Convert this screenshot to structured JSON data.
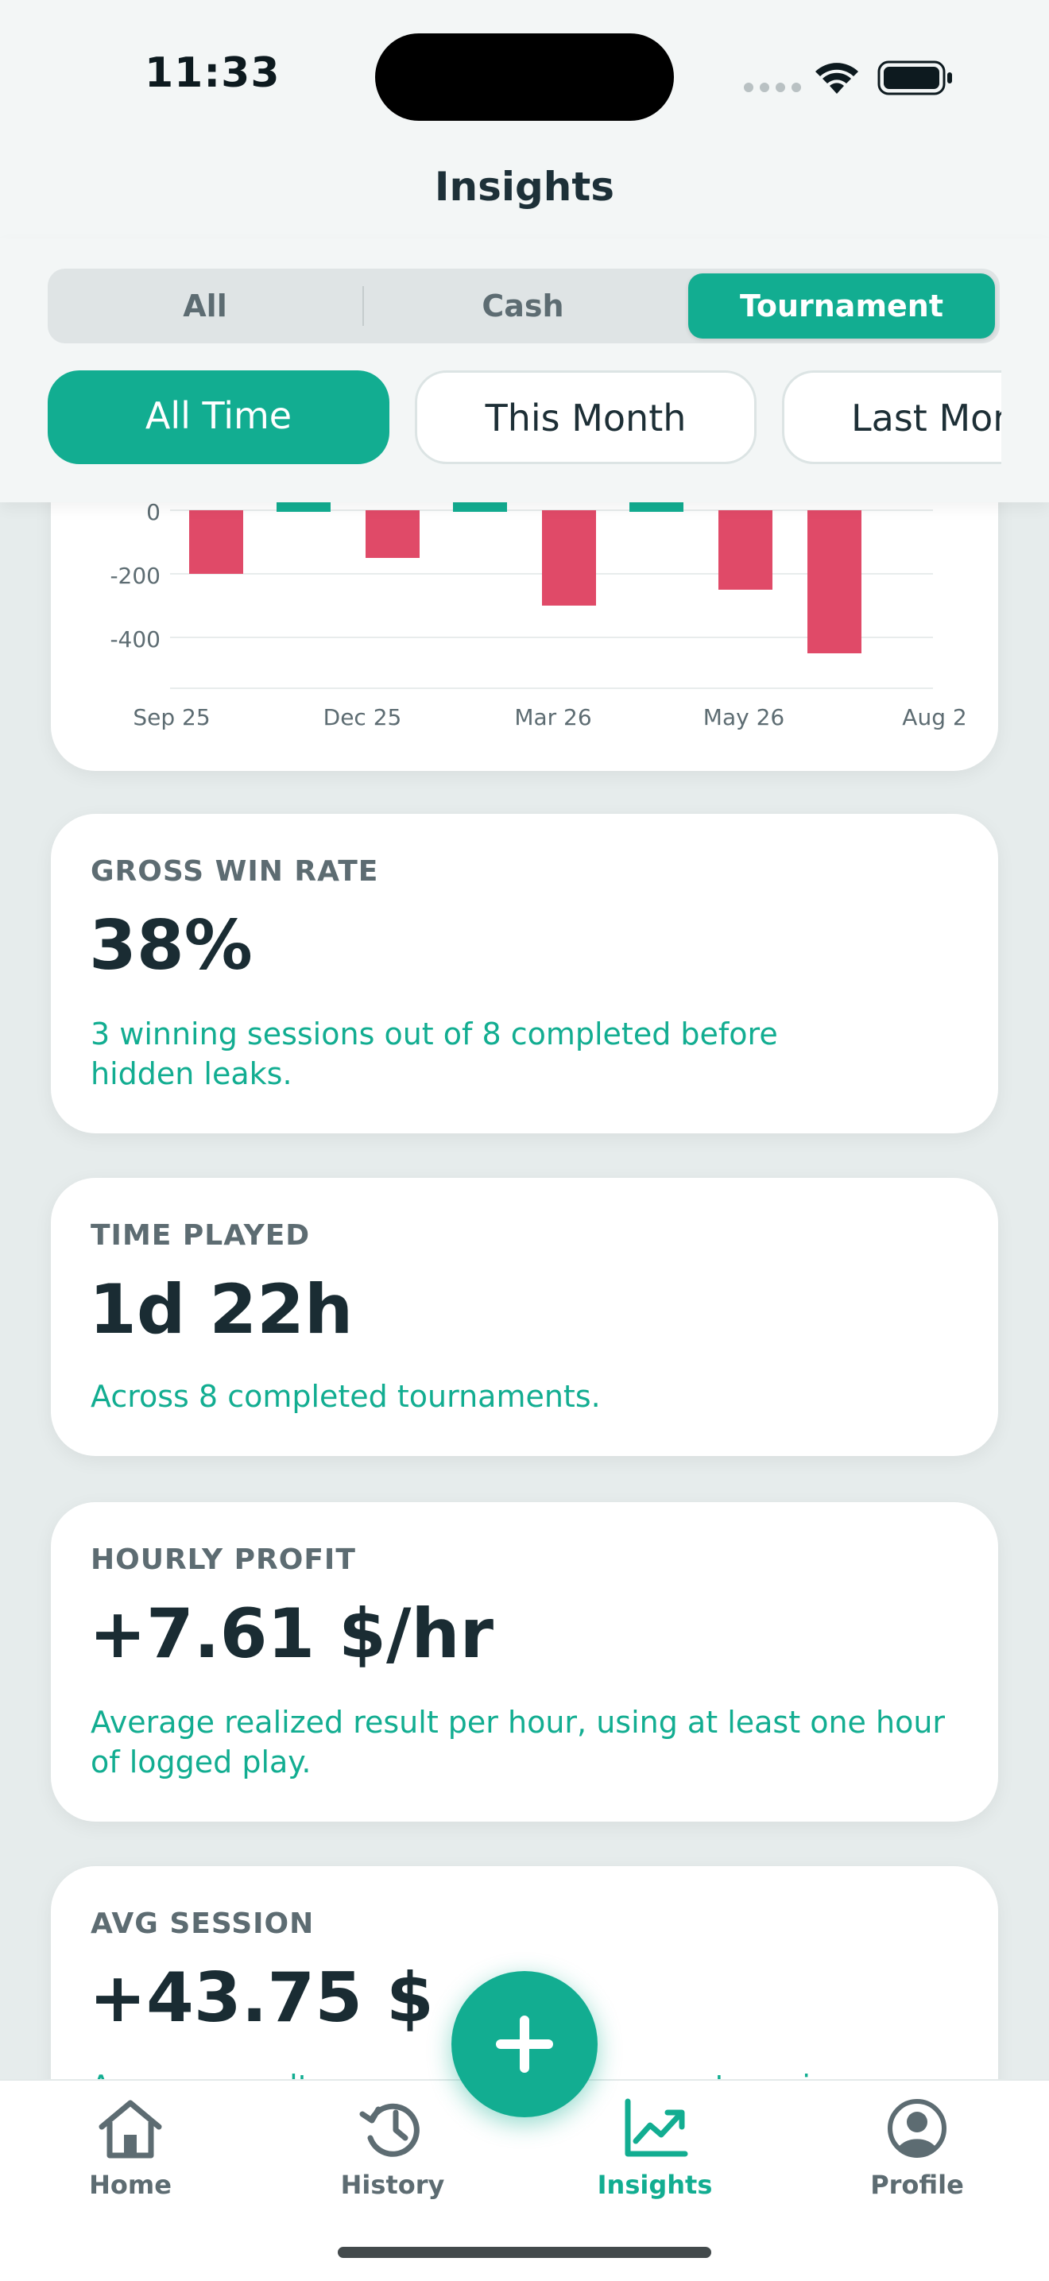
{
  "status_bar": {
    "time": "11:33"
  },
  "header": {
    "title": "Insights"
  },
  "game_filter": {
    "options": [
      "All",
      "Cash",
      "Tournament"
    ],
    "selected": "Tournament"
  },
  "period_filter": {
    "options": [
      "All Time",
      "This Month",
      "Last Mor"
    ],
    "selected": "All Time"
  },
  "colors": {
    "accent": "#12ad91",
    "loss": "#e04a68",
    "text_dark": "#1a2c33",
    "text_muted": "#5d6c72"
  },
  "chart_data": {
    "type": "bar",
    "x_ticks": [
      "Sep 25",
      "Dec 25",
      "Mar 26",
      "May 26",
      "Aug 2"
    ],
    "y_ticks": [
      "0",
      "-200",
      "-400"
    ],
    "ylim": [
      -500,
      0
    ],
    "values": [
      -200,
      10,
      -150,
      10,
      -300,
      10,
      -250,
      -450
    ],
    "grid": true
  },
  "cards": {
    "gross_win_rate": {
      "label": "GROSS WIN RATE",
      "value": "38%",
      "description": "3 winning sessions out of 8 completed before hidden leaks."
    },
    "time_played": {
      "label": "TIME PLAYED",
      "value": "1d 22h",
      "description": "Across 8 completed tournaments."
    },
    "hourly_profit": {
      "label": "HOURLY PROFIT",
      "value": "+7.61 $/hr",
      "description": "Average realized result per hour, using at least one hour of logged play."
    },
    "avg_session": {
      "label": "AVG SESSION",
      "value": "+43.75 $",
      "description": "Average result per completed tournament session."
    }
  },
  "tabbar": {
    "items": [
      {
        "label": "Home",
        "icon": "home-icon"
      },
      {
        "label": "History",
        "icon": "history-icon"
      },
      {
        "label": "Insights",
        "icon": "insights-icon"
      },
      {
        "label": "Profile",
        "icon": "profile-icon"
      }
    ],
    "active": "Insights"
  },
  "fab": {
    "icon": "plus-icon"
  }
}
